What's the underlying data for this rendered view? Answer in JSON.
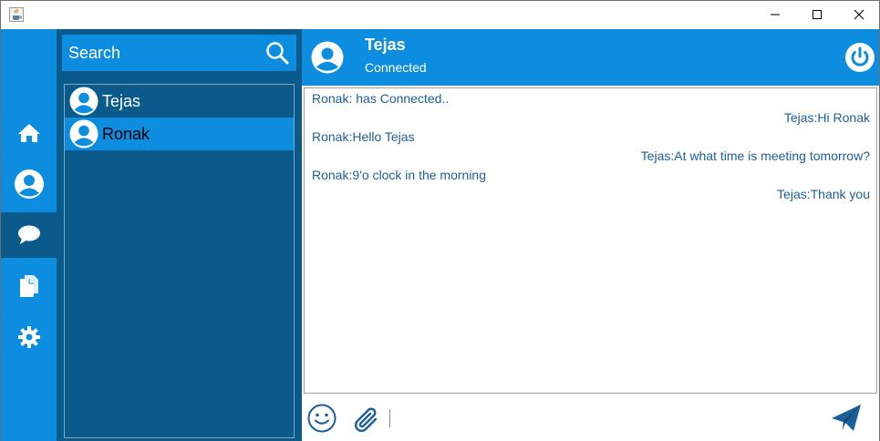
{
  "colors": {
    "primary": "#0d8de0",
    "dark": "#0a5a8c",
    "message_text": "#1c5f9a",
    "window_bg": "#ffffff"
  },
  "window": {
    "icon": "java-cup-icon",
    "controls": [
      "minimize-icon",
      "maximize-icon",
      "close-icon"
    ]
  },
  "nav": {
    "items": [
      {
        "name": "home",
        "icon": "home-icon",
        "active": false
      },
      {
        "name": "profile",
        "icon": "user-icon",
        "active": false
      },
      {
        "name": "chat",
        "icon": "chat-bubble-icon",
        "active": true
      },
      {
        "name": "files",
        "icon": "documents-icon",
        "active": false
      },
      {
        "name": "settings",
        "icon": "gear-icon",
        "active": false
      }
    ]
  },
  "search": {
    "label": "Search",
    "icon": "search-icon"
  },
  "contacts": [
    {
      "name": "Tejas",
      "selected": false
    },
    {
      "name": "Ronak",
      "selected": true
    }
  ],
  "header": {
    "name": "Tejas",
    "status": "Connected",
    "power_icon": "power-icon"
  },
  "messages": [
    {
      "text": "Ronak: has Connected..",
      "side": "left"
    },
    {
      "text": "Tejas:Hi Ronak",
      "side": "right"
    },
    {
      "text": "Ronak:Hello Tejas",
      "side": "left"
    },
    {
      "text": "Tejas:At what time is meeting tomorrow?",
      "side": "right"
    },
    {
      "text": "Ronak:9'o clock in the morning",
      "side": "left"
    },
    {
      "text": "Tejas:Thank you",
      "side": "right"
    }
  ],
  "composer": {
    "value": "",
    "emoji_icon": "emoji-icon",
    "attach_icon": "paperclip-icon",
    "send_icon": "send-icon"
  }
}
